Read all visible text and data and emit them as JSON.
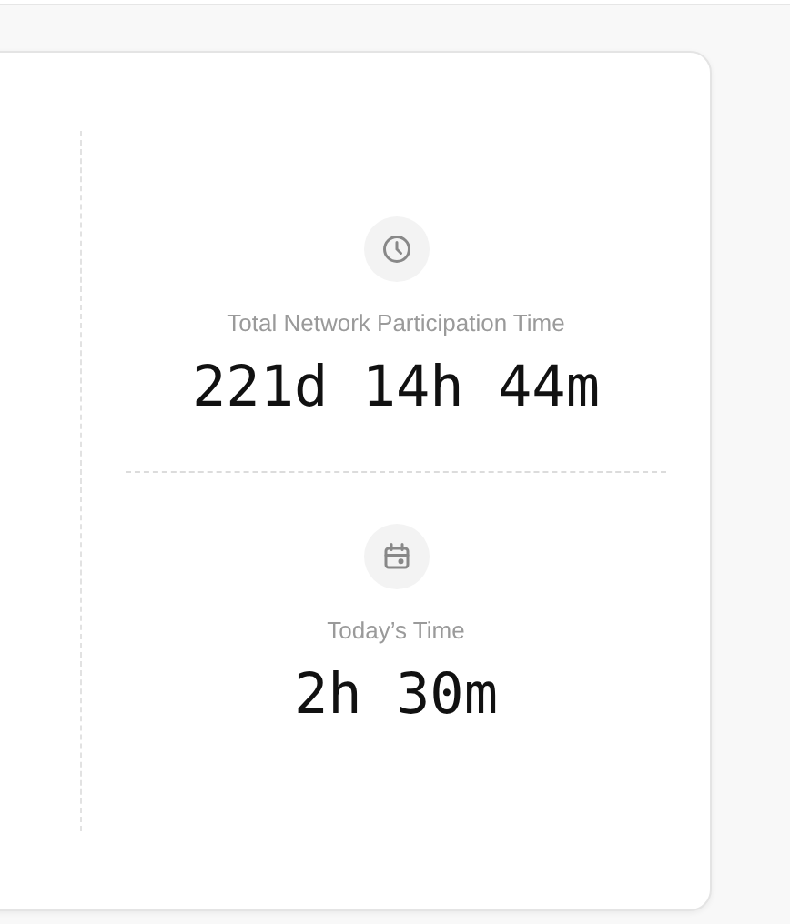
{
  "stats": [
    {
      "label": "Total Network Participation Time",
      "value": "221d 14h 44m"
    },
    {
      "label": "Today’s Time",
      "value": "2h 30m"
    }
  ]
}
